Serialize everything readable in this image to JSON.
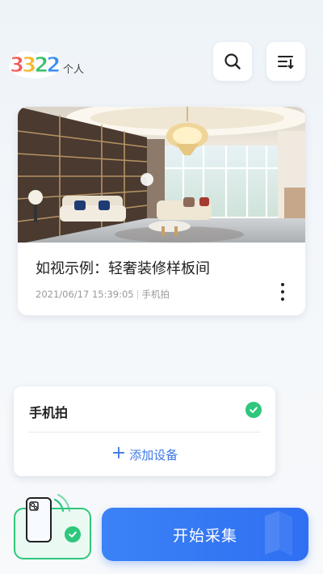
{
  "header": {
    "logo_digits": [
      "3",
      "3",
      "2",
      "2"
    ],
    "logo_digit_colors": [
      "#f25a5a",
      "#f5b72a",
      "#3bbf6a",
      "#3c8ef0"
    ],
    "logo_text": "个人",
    "search_icon": "search-icon",
    "menu_icon": "sort-menu-icon"
  },
  "example_card": {
    "title": "如视示例：轻奢装修样板间",
    "date": "2021/06/17 15:39:05",
    "source": "手机拍",
    "more_icon": "more-vertical-icon"
  },
  "devices": {
    "current_device": "手机拍",
    "add_device_label": "添加设备",
    "check_icon": "check-circle-icon"
  },
  "bottom_bar": {
    "start_label": "开始采集",
    "phone_icon": "phone-device-icon"
  },
  "colors": {
    "accent_blue": "#2f6ff2",
    "link_blue": "#3c78e6",
    "success_green": "#2ec77b"
  }
}
